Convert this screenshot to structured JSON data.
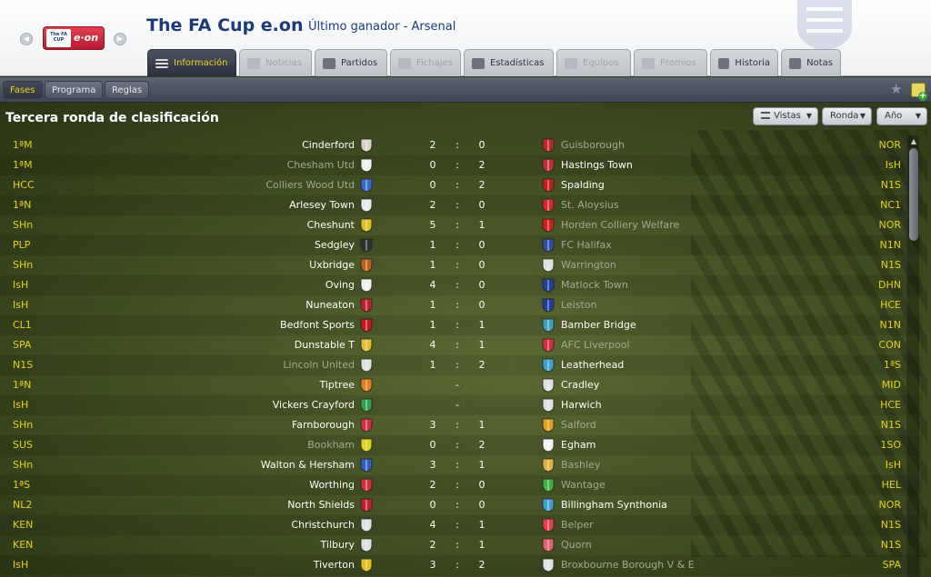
{
  "header": {
    "title": "The FA Cup e.on",
    "subtitle": "Último ganador - Arsenal",
    "logo": {
      "cup_text": "The FA CUP",
      "sponsor_text": "e·on"
    }
  },
  "tabs": [
    {
      "label": "Información",
      "icon": "list-icon",
      "state": "active"
    },
    {
      "label": "Noticias",
      "icon": "newspaper-icon",
      "state": "disabled"
    },
    {
      "label": "Partidos",
      "icon": "shield-icon",
      "state": "normal"
    },
    {
      "label": "Fichajes",
      "icon": "transfer-arrows-icon",
      "state": "disabled"
    },
    {
      "label": "Estadísticas",
      "icon": "bar-chart-icon",
      "state": "normal"
    },
    {
      "label": "Equipos",
      "icon": "shield-icon",
      "state": "disabled"
    },
    {
      "label": "Premios",
      "icon": "trophy-icon",
      "state": "disabled"
    },
    {
      "label": "Historia",
      "icon": "document-icon",
      "state": "normal"
    },
    {
      "label": "Notas",
      "icon": "notepad-icon",
      "state": "normal"
    }
  ],
  "subnav": {
    "fases": "Fases",
    "programa": "Programa",
    "reglas": "Reglas"
  },
  "panel": {
    "title": "Tercera ronda de clasificación",
    "vistas": "Vistas",
    "ronda": "Ronda",
    "anio": "Año"
  },
  "fixtures": [
    {
      "hl": "1ªM",
      "home": "Cinderford",
      "hs": "2",
      "sep": ":",
      "as": "0",
      "away": "Guisborough",
      "al": "NOR",
      "home_dim": false,
      "away_dim": true,
      "hc": "#d8d0c8",
      "ac": "#c0282c"
    },
    {
      "hl": "1ªM",
      "home": "Chesham Utd",
      "hs": "0",
      "sep": ":",
      "as": "2",
      "away": "Hastings Town",
      "al": "IsH",
      "home_dim": true,
      "away_dim": false,
      "hc": "#f0f0f0",
      "ac": "#c03040"
    },
    {
      "hl": "HCC",
      "home": "Colliers Wood Utd",
      "hs": "0",
      "sep": ":",
      "as": "2",
      "away": "Spalding",
      "al": "N1S",
      "home_dim": true,
      "away_dim": false,
      "hc": "#3a6ad0",
      "ac": "#c02020"
    },
    {
      "hl": "1ªN",
      "home": "Arlesey Town",
      "hs": "2",
      "sep": ":",
      "as": "0",
      "away": "St. Aloysius",
      "al": "NC1",
      "home_dim": false,
      "away_dim": true,
      "hc": "#e8e8e8",
      "ac": "#d02830"
    },
    {
      "hl": "SHn",
      "home": "Cheshunt",
      "hs": "5",
      "sep": ":",
      "as": "1",
      "away": "Horden Colliery Welfare",
      "al": "NOR",
      "home_dim": false,
      "away_dim": true,
      "hc": "#e0c020",
      "ac": "#d02020"
    },
    {
      "hl": "PLP",
      "home": "Sedgley",
      "hs": "1",
      "sep": ":",
      "as": "0",
      "away": "FC Halifax",
      "al": "N1N",
      "home_dim": false,
      "away_dim": true,
      "hc": "#303030",
      "ac": "#3050a0"
    },
    {
      "hl": "SHn",
      "home": "Uxbridge",
      "hs": "1",
      "sep": ":",
      "as": "0",
      "away": "Warrington",
      "al": "N1S",
      "home_dim": false,
      "away_dim": true,
      "hc": "#c06020",
      "ac": "#e0e0e0"
    },
    {
      "hl": "IsH",
      "home": "Oving",
      "hs": "4",
      "sep": ":",
      "as": "0",
      "away": "Matlock Town",
      "al": "DHN",
      "home_dim": false,
      "away_dim": true,
      "hc": "#f0f0f0",
      "ac": "#2040a0"
    },
    {
      "hl": "IsH",
      "home": "Nuneaton",
      "hs": "1",
      "sep": ":",
      "as": "0",
      "away": "Leiston",
      "al": "HCE",
      "home_dim": false,
      "away_dim": true,
      "hc": "#c02030",
      "ac": "#2040a0"
    },
    {
      "hl": "CL1",
      "home": "Bedfont Sports",
      "hs": "1",
      "sep": ":",
      "as": "1",
      "away": "Bamber Bridge",
      "al": "N1N",
      "home_dim": false,
      "away_dim": false,
      "hc": "#c01a20",
      "ac": "#40a0c0"
    },
    {
      "hl": "SPA",
      "home": "Dunstable T",
      "hs": "4",
      "sep": ":",
      "as": "1",
      "away": "AFC Liverpool",
      "al": "CON",
      "home_dim": false,
      "away_dim": true,
      "hc": "#e0c030",
      "ac": "#d03040"
    },
    {
      "hl": "N1S",
      "home": "Lincoln United",
      "hs": "1",
      "sep": ":",
      "as": "2",
      "away": "Leatherhead",
      "al": "1ªS",
      "home_dim": true,
      "away_dim": false,
      "hc": "#e0e0e0",
      "ac": "#40a0d0"
    },
    {
      "hl": "1ªN",
      "home": "Tiptree",
      "hs": "",
      "sep": "-",
      "as": "",
      "away": "Cradley",
      "al": "MID",
      "home_dim": false,
      "away_dim": false,
      "hc": "#e08020",
      "ac": "#e0e0e0"
    },
    {
      "hl": "IsH",
      "home": "Vickers Crayford",
      "hs": "",
      "sep": "-",
      "as": "",
      "away": "Harwich",
      "al": "HCE",
      "home_dim": false,
      "away_dim": false,
      "hc": "#30a050",
      "ac": "#e0e0e0"
    },
    {
      "hl": "SHn",
      "home": "Farnborough",
      "hs": "3",
      "sep": ":",
      "as": "1",
      "away": "Salford",
      "al": "N1S",
      "home_dim": false,
      "away_dim": true,
      "hc": "#d03040",
      "ac": "#e0a020"
    },
    {
      "hl": "SUS",
      "home": "Bookham",
      "hs": "0",
      "sep": ":",
      "as": "2",
      "away": "Egham",
      "al": "1SO",
      "home_dim": true,
      "away_dim": false,
      "hc": "#e0d020",
      "ac": "#f0f0f0"
    },
    {
      "hl": "SHn",
      "home": "Walton & Hersham",
      "hs": "3",
      "sep": ":",
      "as": "1",
      "away": "Bashley",
      "al": "IsH",
      "home_dim": false,
      "away_dim": true,
      "hc": "#3060c0",
      "ac": "#e0b040"
    },
    {
      "hl": "1ªS",
      "home": "Worthing",
      "hs": "2",
      "sep": ":",
      "as": "0",
      "away": "Wantage",
      "al": "HEL",
      "home_dim": false,
      "away_dim": true,
      "hc": "#d03040",
      "ac": "#40b040"
    },
    {
      "hl": "NL2",
      "home": "North Shields",
      "hs": "0",
      "sep": ":",
      "as": "0",
      "away": "Billingham Synthonia",
      "al": "NOR",
      "home_dim": false,
      "away_dim": false,
      "hc": "#c02030",
      "ac": "#40a0d0"
    },
    {
      "hl": "KEN",
      "home": "Christchurch",
      "hs": "4",
      "sep": ":",
      "as": "1",
      "away": "Belper",
      "al": "N1S",
      "home_dim": false,
      "away_dim": true,
      "hc": "#e0e0e0",
      "ac": "#e04050"
    },
    {
      "hl": "KEN",
      "home": "Tilbury",
      "hs": "2",
      "sep": ":",
      "as": "1",
      "away": "Quorn",
      "al": "N1S",
      "home_dim": false,
      "away_dim": true,
      "hc": "#e0e0e0",
      "ac": "#e06070"
    },
    {
      "hl": "IsH",
      "home": "Tiverton",
      "hs": "3",
      "sep": ":",
      "as": "2",
      "away": "Broxbourne Borough V & E",
      "al": "SPA",
      "home_dim": false,
      "away_dim": true,
      "hc": "#e0c020",
      "ac": "#e0e0e0"
    }
  ]
}
